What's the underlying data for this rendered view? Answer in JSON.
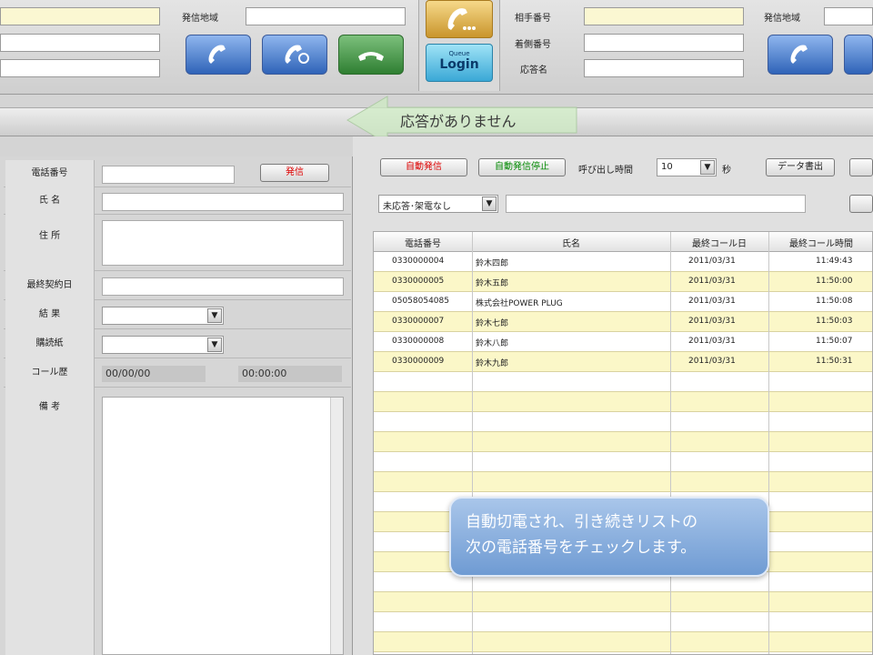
{
  "topbar": {
    "left": {
      "caller_area_label": "発信地域"
    },
    "right": {
      "other_number_label": "相手番号",
      "own_number_label": "着側番号",
      "responder_label": "応答名",
      "caller_area_label": "発信地域"
    },
    "login": {
      "small": "Queue",
      "big": "Login"
    }
  },
  "status_banner": "応答がありません",
  "form": {
    "phone_label": "電話番号",
    "call_button": "発信",
    "name_label": "氏 名",
    "address_label": "住 所",
    "last_contract_label": "最終契約日",
    "result_label": "結 果",
    "purchase_label": "購読紙",
    "call_history_label": "コール歴",
    "call_history_date": "00/00/00",
    "call_history_time": "00:00:00",
    "notes_label": "備 考"
  },
  "controls": {
    "auto_call_button": "自動発信",
    "auto_call_stop_button": "自動発信停止",
    "ring_time_label": "呼び出し時間",
    "ring_time_value": "10",
    "ring_time_unit": "秒",
    "export_button": "データ書出",
    "filter_value": "未応答･架電なし"
  },
  "table": {
    "columns": [
      "電話番号",
      "氏名",
      "最終コール日",
      "最終コール時間"
    ],
    "rows": [
      [
        "0330000004",
        "鈴木四郎",
        "2011/03/31",
        "11:49:43"
      ],
      [
        "0330000005",
        "鈴木五郎",
        "2011/03/31",
        "11:50:00"
      ],
      [
        "05058054085",
        "株式会社POWER PLUG",
        "2011/03/31",
        "11:50:08"
      ],
      [
        "0330000007",
        "鈴木七郎",
        "2011/03/31",
        "11:50:03"
      ],
      [
        "0330000008",
        "鈴木八郎",
        "2011/03/31",
        "11:50:07"
      ],
      [
        "0330000009",
        "鈴木九郎",
        "2011/03/31",
        "11:50:31"
      ]
    ]
  },
  "callout": {
    "line1": "自動切電され、引き続きリストの",
    "line2": "次の電話番号をチェックします。"
  },
  "colors": {
    "row_yellow": "#fbf7c8",
    "callout_blue": "#7ea6d9",
    "call_button_text": "#dd0000",
    "auto_stop_text": "#008800"
  }
}
